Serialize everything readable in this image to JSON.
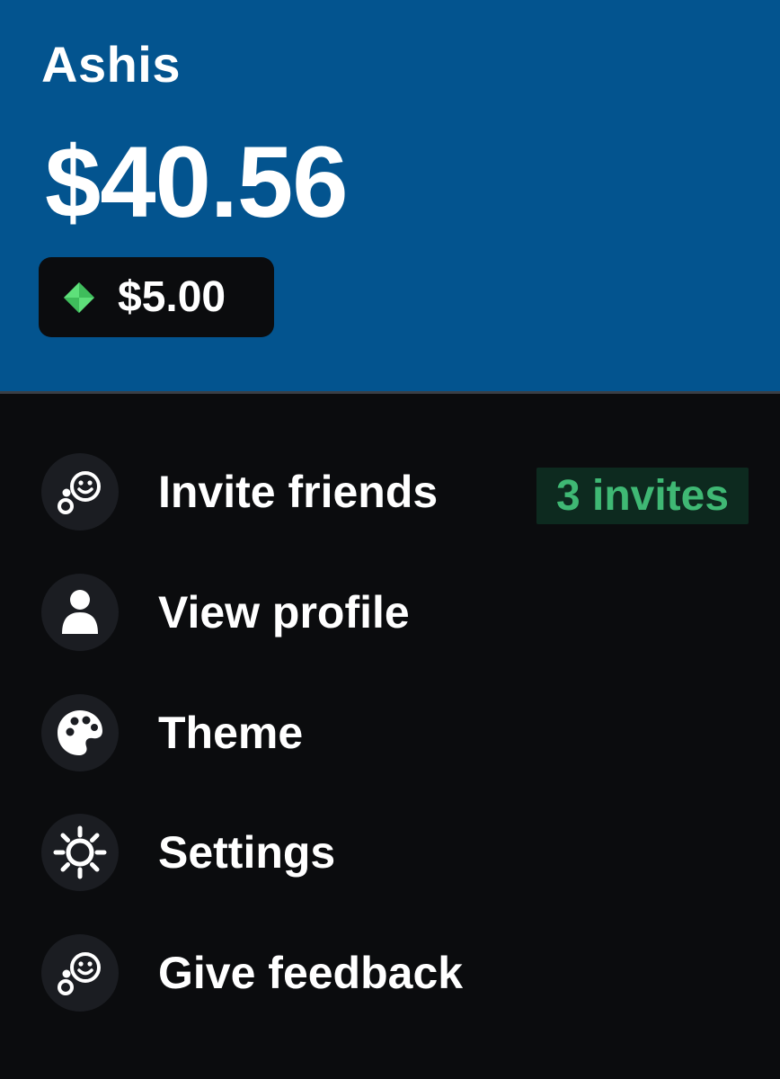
{
  "user": {
    "name": "Ashis",
    "balance": "$40.56"
  },
  "reward": {
    "amount": "$5.00",
    "icon": "diamond-icon",
    "icon_color": "#5ee07a"
  },
  "colors": {
    "header_bg": "#03548f",
    "page_bg": "#0b0c0e",
    "icon_circle_bg": "#1b1d22",
    "badge_text": "#3fb874",
    "badge_bg": "#0d2a1f"
  },
  "menu": {
    "items": [
      {
        "label": "Invite friends",
        "icon": "smiley-group-icon",
        "badge": "3 invites"
      },
      {
        "label": "View profile",
        "icon": "person-icon"
      },
      {
        "label": "Theme",
        "icon": "palette-icon"
      },
      {
        "label": "Settings",
        "icon": "gear-icon"
      },
      {
        "label": "Give feedback",
        "icon": "smiley-group-icon"
      }
    ]
  }
}
